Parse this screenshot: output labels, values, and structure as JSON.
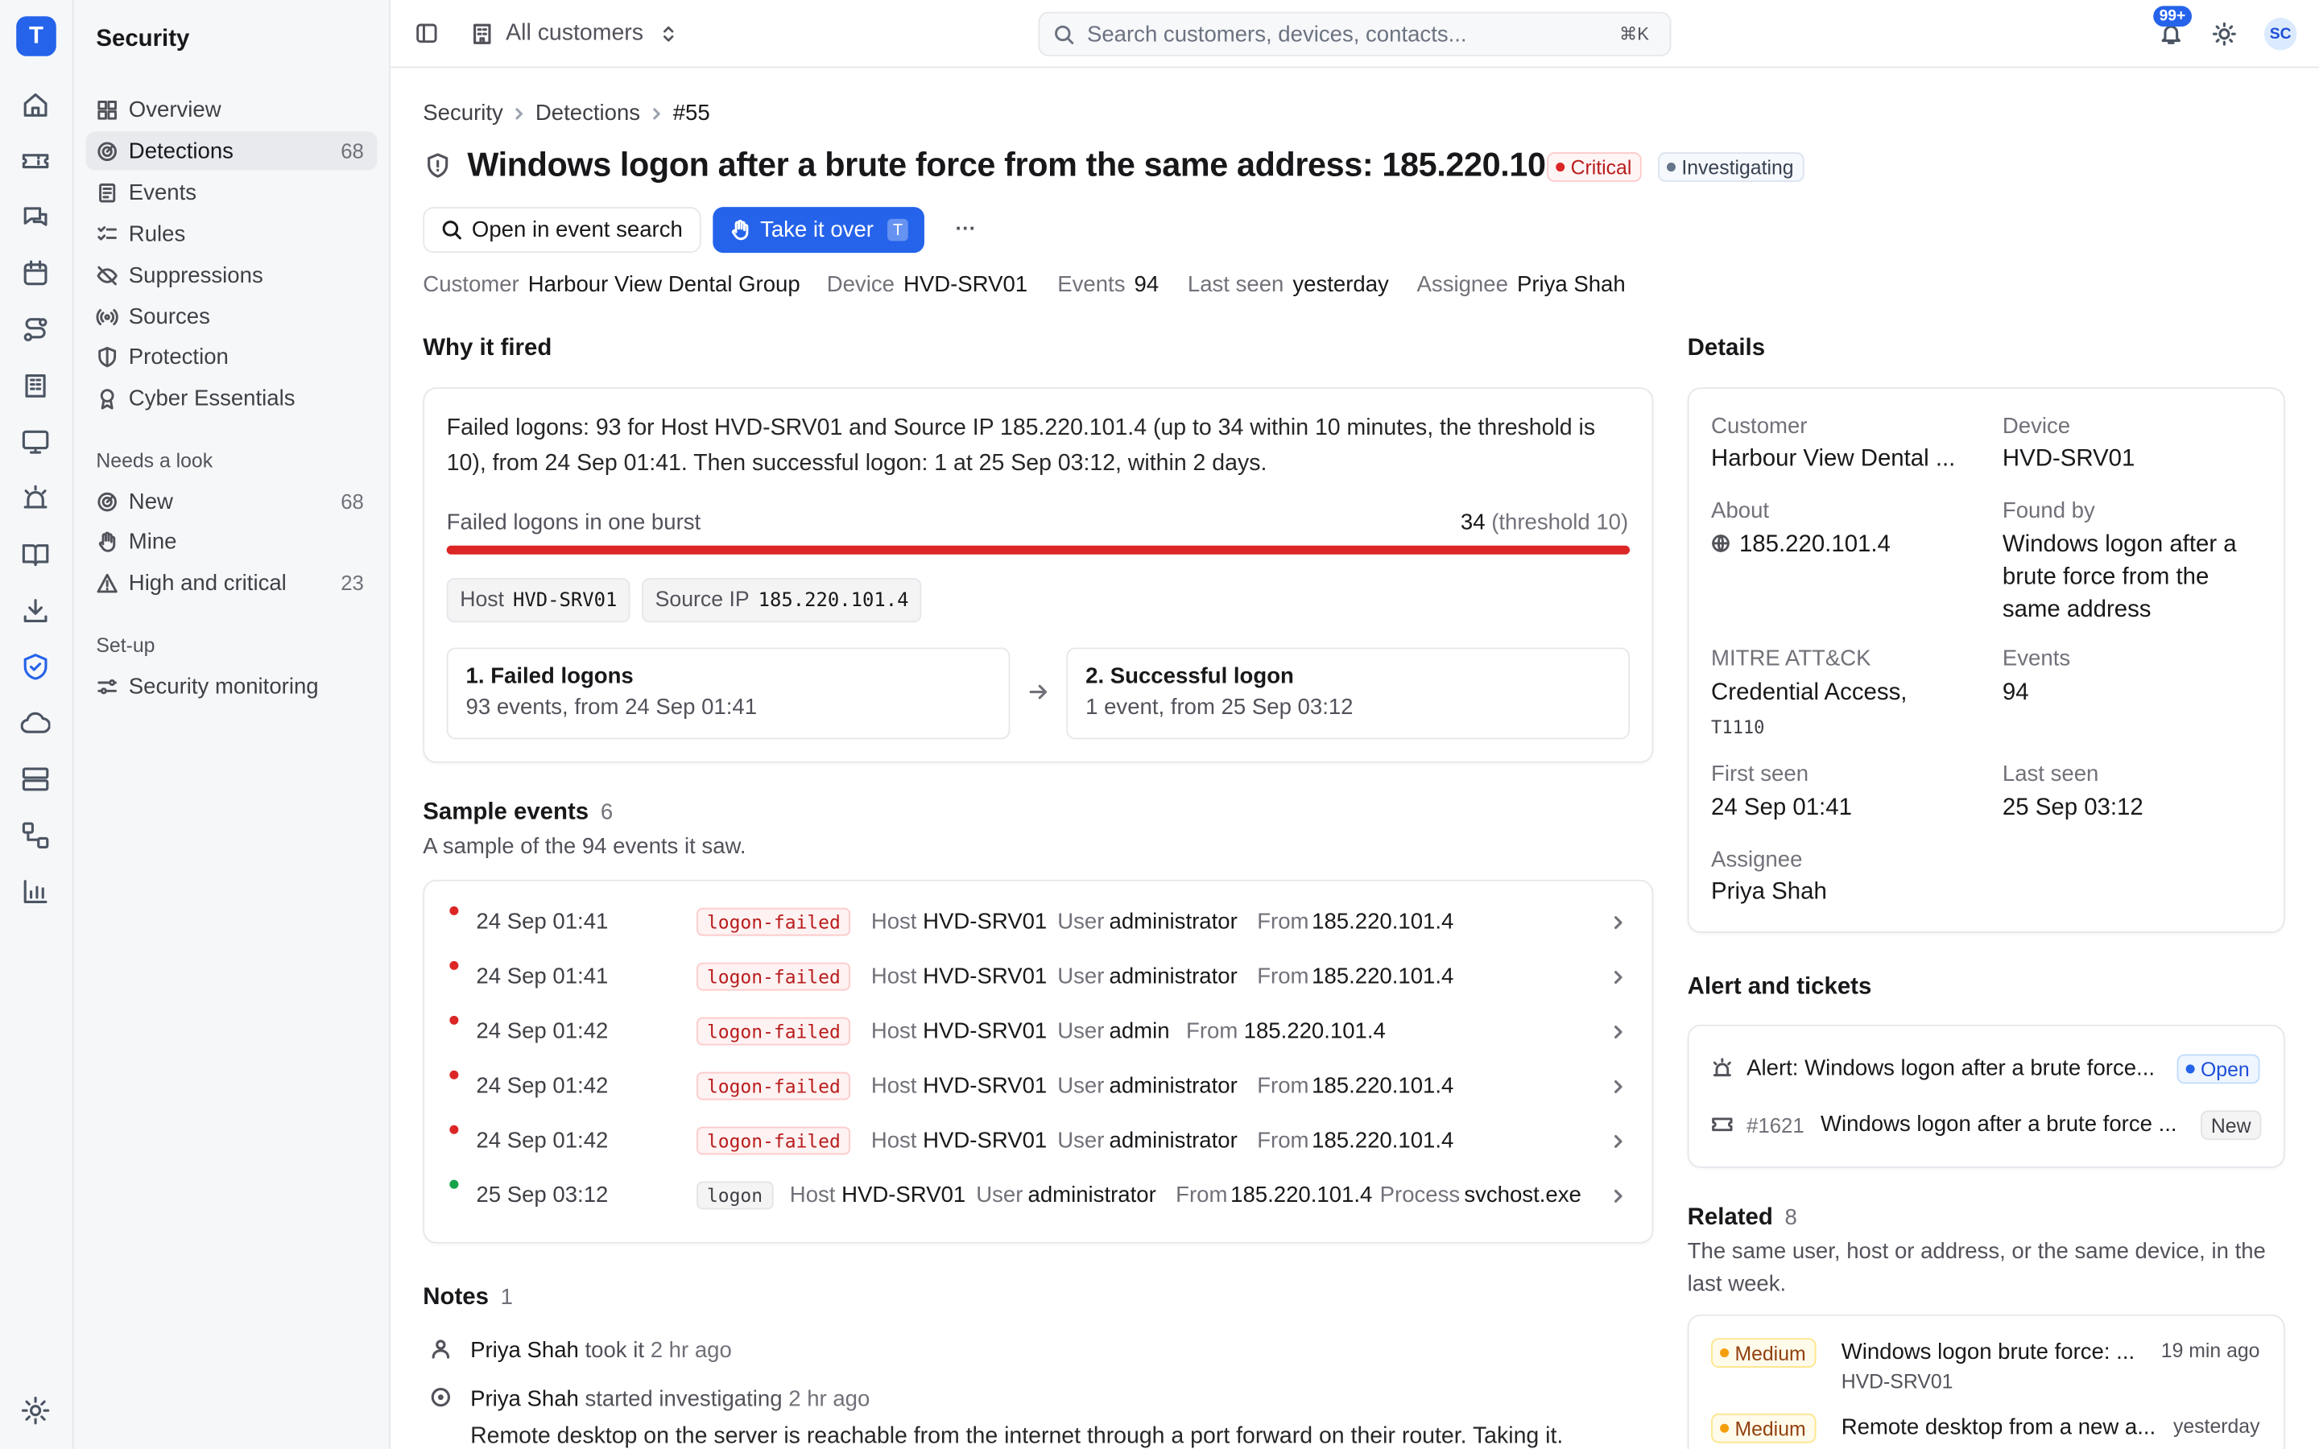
{
  "app": {
    "logo_letter": "T",
    "section_title": "Security",
    "colors": {
      "accent": "#2563eb",
      "critical": "#dc2626",
      "ok": "#16a34a"
    }
  },
  "rail": {
    "icons": [
      "home-icon",
      "ticket-icon",
      "chat-icon",
      "calendar-icon",
      "route-icon",
      "building-icon",
      "monitor-icon",
      "siren-icon",
      "book-icon",
      "download-icon",
      "shield-icon",
      "cloud-icon",
      "server-icon",
      "workflow-icon",
      "chart-icon",
      "settings-icon"
    ]
  },
  "sidebar": {
    "items": [
      {
        "label": "Overview",
        "count": ""
      },
      {
        "label": "Detections",
        "count": "68"
      },
      {
        "label": "Events",
        "count": ""
      },
      {
        "label": "Rules",
        "count": ""
      },
      {
        "label": "Suppressions",
        "count": ""
      },
      {
        "label": "Sources",
        "count": ""
      },
      {
        "label": "Protection",
        "count": ""
      },
      {
        "label": "Cyber Essentials",
        "count": ""
      }
    ],
    "needs_look_title": "Needs a look",
    "needs_look": [
      {
        "label": "New",
        "count": "68"
      },
      {
        "label": "Mine",
        "count": ""
      },
      {
        "label": "High and critical",
        "count": "23"
      }
    ],
    "setup_title": "Set-up",
    "setup": [
      {
        "label": "Security monitoring"
      }
    ]
  },
  "topbar": {
    "scope": "All customers",
    "search_placeholder": "Search customers, devices, contacts...",
    "search_kbd": "⌘K",
    "notif_badge": "99+",
    "avatar": "SC"
  },
  "breadcrumb": [
    "Security",
    "Detections",
    "#55"
  ],
  "detection": {
    "title": "Windows logon after a brute force from the same address: 185.220.101.4",
    "severity": "Critical",
    "status": "Investigating",
    "open_search": "Open in event search",
    "take_over": "Take it over",
    "take_over_kbd": "T",
    "more": "···",
    "meta": [
      {
        "k": "Customer",
        "v": "Harbour View Dental Group"
      },
      {
        "k": "Device",
        "v": "HVD-SRV01"
      },
      {
        "k": "Events",
        "v": "94"
      },
      {
        "k": "Last seen",
        "v": "yesterday"
      },
      {
        "k": "Assignee",
        "v": "Priya Shah"
      }
    ]
  },
  "why": {
    "title": "Why it fired",
    "line1": "Failed logons: 93 for Host HVD-SRV01 and Source IP 185.220.101.4 (up to 34 within 10 minutes, the threshold is",
    "line2": "10), from 24 Sep 01:41. Then successful logon: 1 at 25 Sep 03:12, within 2 days.",
    "burst_label": "Failed logons in one burst",
    "burst_value": "34",
    "burst_threshold": "(threshold 10)",
    "burst_fill": 1.0,
    "tags": [
      {
        "k": "Host",
        "v": "HVD-SRV01"
      },
      {
        "k": "Source IP",
        "v": "185.220.101.4"
      }
    ],
    "steps": [
      {
        "h": "1. Failed logons",
        "d": "93 events, from 24 Sep 01:41"
      },
      {
        "h": "2. Successful logon",
        "d": "1 event, from 25 Sep 03:12"
      }
    ]
  },
  "samples": {
    "title": "Sample events",
    "count": "6",
    "sub": "A sample of the 94 events it saw.",
    "rows": [
      {
        "time": "24 Sep 01:41",
        "label": "logon-failed",
        "host": "HVD-SRV01",
        "user": "administrator",
        "from": "185.220.101.4",
        "process": ""
      },
      {
        "time": "24 Sep 01:41",
        "label": "logon-failed",
        "host": "HVD-SRV01",
        "user": "administrator",
        "from": "185.220.101.4",
        "process": ""
      },
      {
        "time": "24 Sep 01:42",
        "label": "logon-failed",
        "host": "HVD-SRV01",
        "user": "admin",
        "from": "185.220.101.4",
        "process": ""
      },
      {
        "time": "24 Sep 01:42",
        "label": "logon-failed",
        "host": "HVD-SRV01",
        "user": "administrator",
        "from": "185.220.101.4",
        "process": ""
      },
      {
        "time": "24 Sep 01:42",
        "label": "logon-failed",
        "host": "HVD-SRV01",
        "user": "administrator",
        "from": "185.220.101.4",
        "process": ""
      },
      {
        "time": "25 Sep 03:12",
        "label": "logon",
        "host": "HVD-SRV01",
        "user": "administrator",
        "from": "185.220.101.4",
        "process": "svchost.exe"
      }
    ],
    "k_host": "Host",
    "k_user": "User",
    "k_from": "From",
    "k_process": "Process"
  },
  "notes": {
    "title": "Notes",
    "count": "1",
    "items": [
      {
        "who": "Priya Shah",
        "what": "took it",
        "when": "2 hr ago"
      },
      {
        "who": "Priya Shah",
        "what": "started investigating",
        "when": "2 hr ago",
        "body": "Remote desktop on the server is reachable from the internet through a port forward on their router. Taking it."
      }
    ]
  },
  "details": {
    "title": "Details",
    "customer_k": "Customer",
    "customer_v": "Harbour View Dental ...",
    "device_k": "Device",
    "device_v": "HVD-SRV01",
    "about_k": "About",
    "about_v": "185.220.101.4",
    "found_k": "Found by",
    "found_v": [
      "Windows logon after a",
      "brute force from the",
      "same address"
    ],
    "mitre_k": "MITRE ATT&CK",
    "mitre_v": "Credential Access,",
    "mitre_id": "T1110",
    "events_k": "Events",
    "events_v": "94",
    "first_k": "First seen",
    "first_v": "24 Sep 01:41",
    "last_k": "Last seen",
    "last_v": "25 Sep 03:12",
    "assignee_k": "Assignee",
    "assignee_v": "Priya Shah"
  },
  "alerts": {
    "title": "Alert and tickets",
    "alert_text": "Alert: Windows logon after a brute force...",
    "alert_status": "Open",
    "ticket_id": "#1621",
    "ticket_text": "Windows logon after a brute force ...",
    "ticket_status": "New"
  },
  "related": {
    "title": "Related",
    "count": "8",
    "sub1": "The same user, host or address, or the same device, in the",
    "sub2": "last week.",
    "items": [
      {
        "sev": "Medium",
        "title": "Windows logon brute force: ...",
        "host": "HVD-SRV01",
        "when": "19 min ago"
      },
      {
        "sev": "Medium",
        "title": "Remote desktop from a new a...",
        "host": "",
        "when": "yesterday"
      }
    ]
  }
}
